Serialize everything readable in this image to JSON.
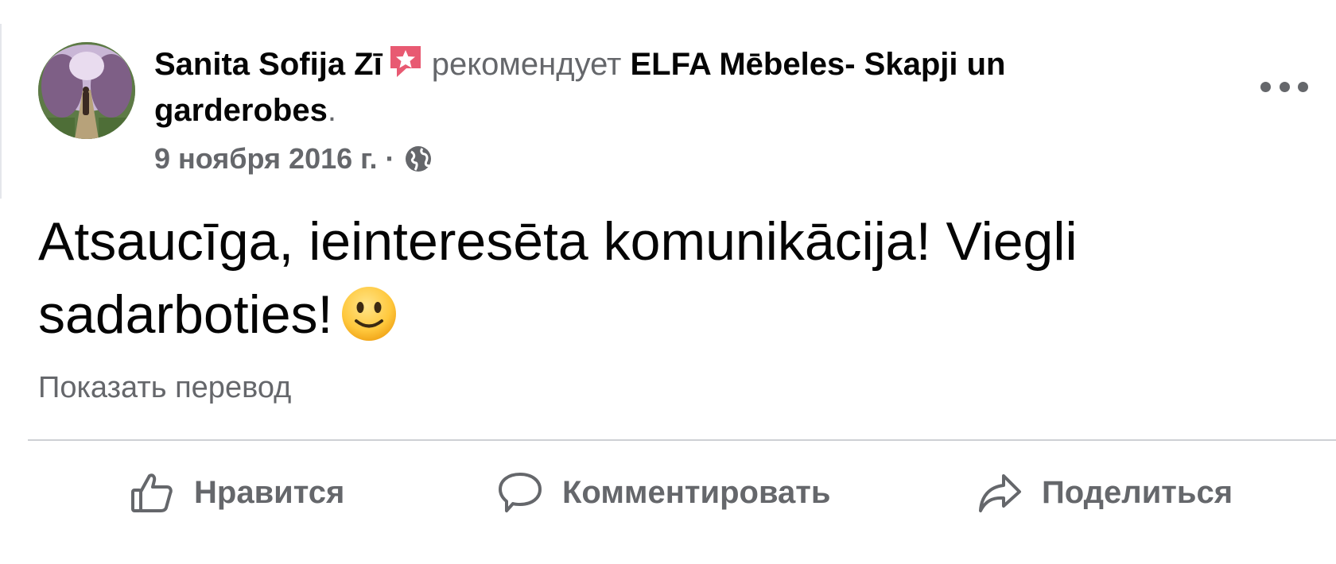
{
  "post": {
    "author": "Sanita Sofija Zī",
    "verb": "рекомендует",
    "page_name": "ELFA Mēbeles- Skapji un garderobes",
    "period": ".",
    "date": "9 ноября 2016 г.",
    "separator": "·",
    "privacy_icon": "globe-icon",
    "text": "Atsaucīga, ieinteresēta komunikācija! Viegli sadarboties!",
    "emoji": "slightly-smiling-face",
    "show_translation": "Показать перевод"
  },
  "actions": {
    "like": "Нравится",
    "comment": "Комментировать",
    "share": "Поделиться"
  },
  "colors": {
    "text": "#050505",
    "muted": "#65676b",
    "divider": "#ced0d4",
    "recommend_badge": "#e85a72"
  }
}
